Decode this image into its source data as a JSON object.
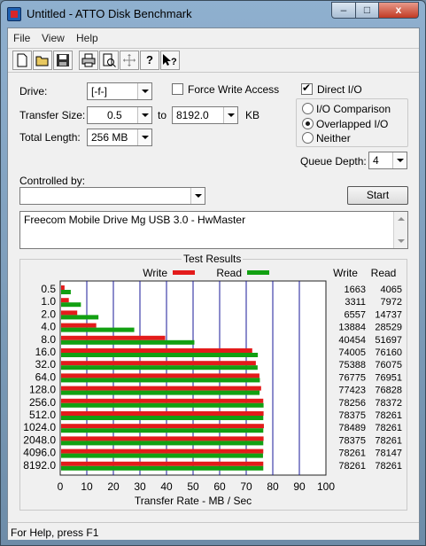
{
  "window": {
    "title": "Untitled - ATTO Disk Benchmark"
  },
  "titlebar_buttons": {
    "minimize": "–",
    "maximize": "□",
    "close": "x"
  },
  "menu": [
    "File",
    "View",
    "Help"
  ],
  "toolbar_icons": [
    "new-document-icon",
    "open-folder-icon",
    "save-icon",
    "print-icon",
    "print-preview-icon",
    "move-icon",
    "help-icon",
    "context-help-icon"
  ],
  "settings": {
    "drive_label": "Drive:",
    "drive_value": "[-f-]",
    "force_write_access_label": "Force Write Access",
    "force_write_access_checked": false,
    "direct_io_label": "Direct I/O",
    "direct_io_checked": true,
    "transfer_size_label": "Transfer Size:",
    "transfer_size_from": "0.5",
    "to_label": "to",
    "transfer_size_to": "8192.0",
    "kb_label": "KB",
    "total_length_label": "Total Length:",
    "total_length_value": "256 MB",
    "io_options": [
      "I/O Comparison",
      "Overlapped I/O",
      "Neither"
    ],
    "io_selected": 1,
    "queue_depth_label": "Queue Depth:",
    "queue_depth_value": "4",
    "controlled_by_label": "Controlled by:",
    "controlled_by_value": "",
    "start_label": "Start",
    "description": "Freecom Mobile Drive Mg USB 3.0 - HwMaster"
  },
  "results": {
    "title": "Test Results",
    "legend_write": "Write",
    "legend_read": "Read",
    "col_write": "Write",
    "col_read": "Read",
    "write_color": "#e31b1b",
    "read_color": "#12a012",
    "grid_color": "#1a1a9a"
  },
  "chart_data": {
    "type": "bar",
    "orientation": "horizontal",
    "categories": [
      "0.5",
      "1.0",
      "2.0",
      "4.0",
      "8.0",
      "16.0",
      "32.0",
      "64.0",
      "128.0",
      "256.0",
      "512.0",
      "1024.0",
      "2048.0",
      "4096.0",
      "8192.0"
    ],
    "series": [
      {
        "name": "Write",
        "values": [
          1663,
          3311,
          6557,
          13884,
          40454,
          74005,
          75388,
          76775,
          77423,
          78256,
          78375,
          78489,
          78375,
          78261,
          78261
        ]
      },
      {
        "name": "Read",
        "values": [
          4065,
          7972,
          14737,
          28529,
          51697,
          76160,
          76075,
          76951,
          76828,
          78372,
          78261,
          78261,
          78261,
          78147,
          78261
        ]
      }
    ],
    "x_ticks": [
      "0",
      "10",
      "20",
      "30",
      "40",
      "50",
      "60",
      "70",
      "80",
      "90",
      "100"
    ],
    "xlim": [
      0,
      100
    ],
    "xlabel": "Transfer Rate - MB / Sec",
    "grid": true,
    "legend_position": "top"
  },
  "status": {
    "text": "For Help, press F1"
  }
}
